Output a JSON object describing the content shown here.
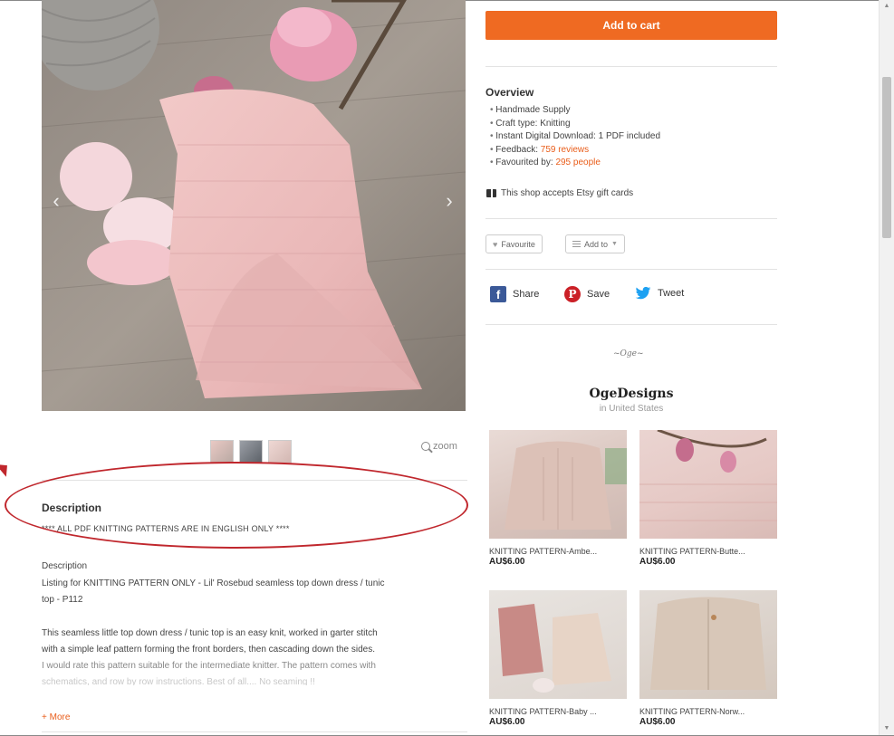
{
  "listing": {
    "add_to_cart_label": "Add to cart",
    "zoom_label": "zoom",
    "carousel_prev": "‹",
    "carousel_next": "›"
  },
  "overview": {
    "heading": "Overview",
    "items": {
      "handmade": "Handmade Supply",
      "craft_type": "Craft type: Knitting",
      "download": "Instant Digital Download: 1 PDF included",
      "feedback_prefix": "Feedback: ",
      "feedback_link": "759 reviews",
      "favourited_prefix": "Favourited by: ",
      "favourited_link": "295 people"
    },
    "gift_cards": "This shop accepts Etsy gift cards"
  },
  "actions": {
    "favourite_label": "Favourite",
    "add_to_label": "Add to",
    "share_label": "Share",
    "save_label": "Save",
    "tweet_label": "Tweet"
  },
  "shop": {
    "logo_text": "~Oge~",
    "name": "OgeDesigns",
    "location": "in United States"
  },
  "related_products": [
    {
      "title": "KNITTING PATTERN-Ambe...",
      "price": "AU$6.00"
    },
    {
      "title": "KNITTING PATTERN-Butte...",
      "price": "AU$6.00"
    },
    {
      "title": "KNITTING PATTERN-Baby ...",
      "price": "AU$6.00"
    },
    {
      "title": "KNITTING PATTERN-Norw...",
      "price": "AU$6.00"
    }
  ],
  "description": {
    "heading": "Description",
    "note": "**** ALL PDF KNITTING PATTERNS ARE IN ENGLISH ONLY ****",
    "label": "Description",
    "line1": "Listing for KNITTING PATTERN ONLY - Lil' Rosebud seamless top down dress / tunic",
    "line2": "top - P112",
    "line3": "This seamless little top down dress / tunic top is an easy knit, worked in garter stitch",
    "line4": "with a simple leaf pattern forming the front borders, then cascading down the sides.",
    "line5": "I would rate this pattern suitable for the intermediate knitter. The pattern comes with",
    "line6": "schematics, and row by row instructions. Best of all.... No seaming !!",
    "more_label": "+ More"
  },
  "colors": {
    "accent_orange": "#ef6a22",
    "link_orange": "#e95d1a",
    "annotation_red": "#c0272d"
  }
}
